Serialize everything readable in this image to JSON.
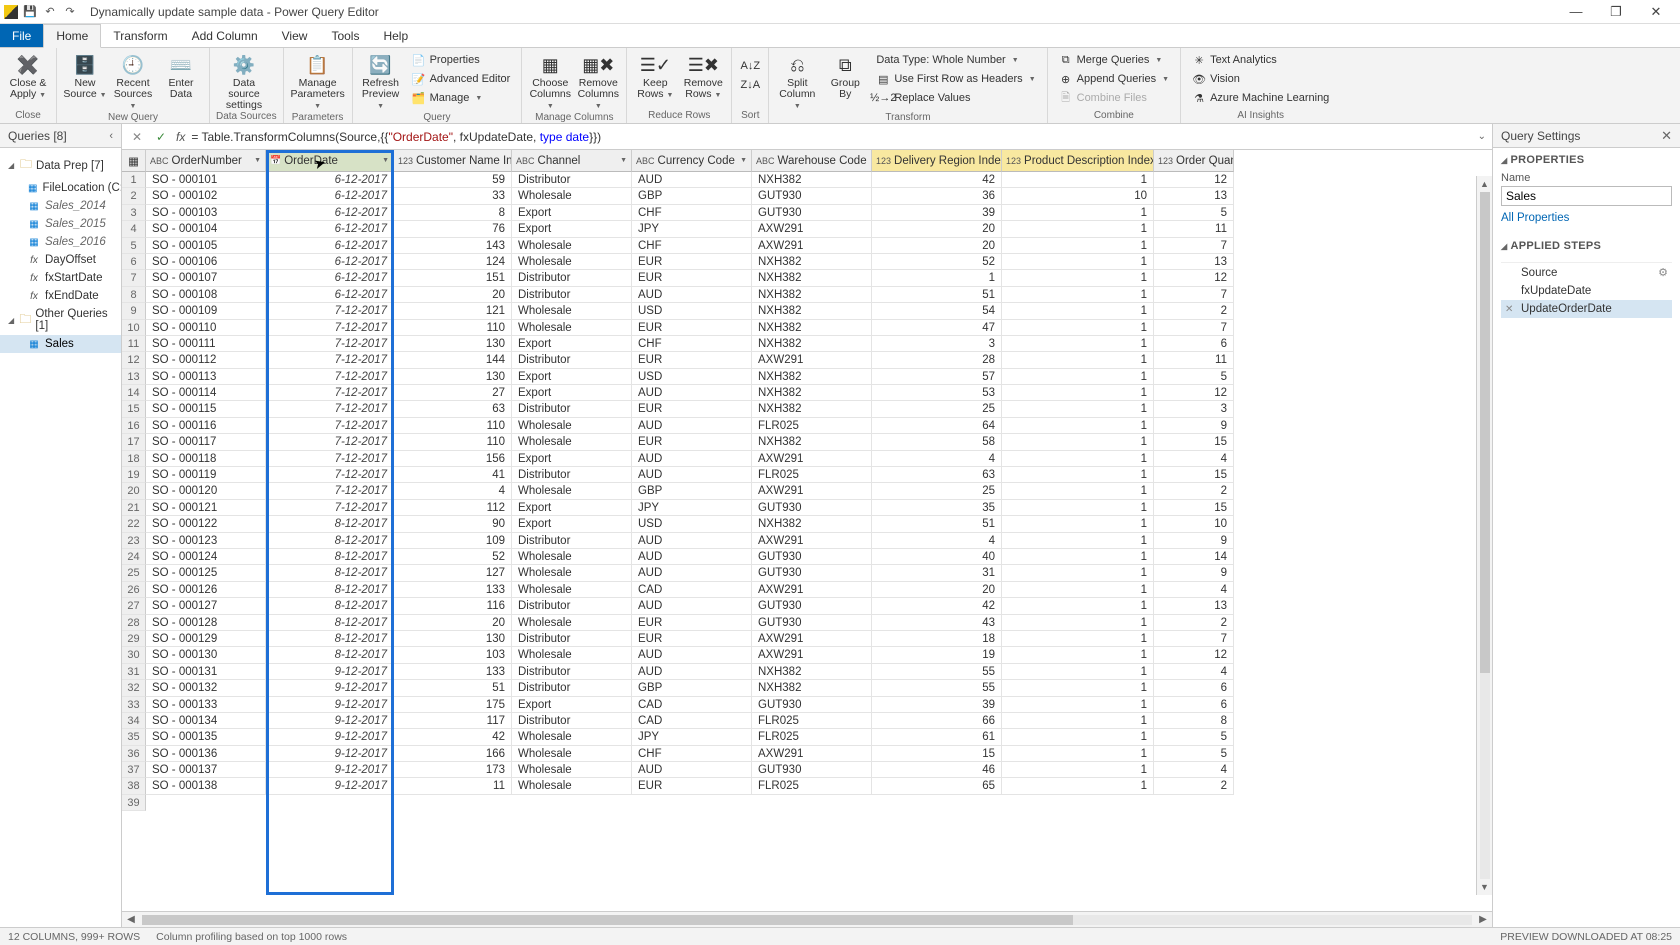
{
  "title": "Dynamically update sample data - Power Query Editor",
  "menuTabs": {
    "file": "File",
    "home": "Home",
    "transform": "Transform",
    "addColumn": "Add Column",
    "view": "View",
    "tools": "Tools",
    "help": "Help"
  },
  "ribbon": {
    "close": {
      "closeApply": "Close &\nApply",
      "group": "Close"
    },
    "newQuery": {
      "newSource": "New\nSource",
      "recentSources": "Recent\nSources",
      "enterData": "Enter\nData",
      "group": "New Query"
    },
    "dataSources": {
      "settings": "Data source\nsettings",
      "group": "Data Sources"
    },
    "parameters": {
      "manage": "Manage\nParameters",
      "group": "Parameters"
    },
    "query": {
      "refresh": "Refresh\nPreview",
      "properties": "Properties",
      "advEditor": "Advanced Editor",
      "manageQ": "Manage",
      "group": "Query"
    },
    "manageColumns": {
      "choose": "Choose\nColumns",
      "remove": "Remove\nColumns",
      "group": "Manage Columns"
    },
    "reduceRows": {
      "keep": "Keep\nRows",
      "removeR": "Remove\nRows",
      "group": "Reduce Rows"
    },
    "sort": {
      "group": "Sort"
    },
    "transform": {
      "split": "Split\nColumn",
      "groupBy": "Group\nBy",
      "dataType": "Data Type: Whole Number",
      "firstRow": "Use First Row as Headers",
      "replace": "Replace Values",
      "group": "Transform"
    },
    "combine": {
      "merge": "Merge Queries",
      "append": "Append Queries",
      "combineFiles": "Combine Files",
      "group": "Combine"
    },
    "ai": {
      "textAnalytics": "Text Analytics",
      "vision": "Vision",
      "azureML": "Azure Machine Learning",
      "group": "AI Insights"
    }
  },
  "queriesPanel": {
    "title": "Queries [8]",
    "groups": [
      {
        "name": "Data Prep [7]",
        "items": [
          {
            "label": "FileLocation (C:\\...",
            "type": "table"
          },
          {
            "label": "Sales_2014",
            "type": "table-italic"
          },
          {
            "label": "Sales_2015",
            "type": "table-italic"
          },
          {
            "label": "Sales_2016",
            "type": "table-italic"
          },
          {
            "label": "DayOffset",
            "type": "fx"
          },
          {
            "label": "fxStartDate",
            "type": "fx"
          },
          {
            "label": "fxEndDate",
            "type": "fx"
          }
        ]
      },
      {
        "name": "Other Queries [1]",
        "items": [
          {
            "label": "Sales",
            "type": "table",
            "selected": true
          }
        ]
      }
    ]
  },
  "formula": {
    "pre": "= Table.TransformColumns(Source,{{",
    "str": "\"OrderDate\"",
    "mid": ", fxUpdateDate, ",
    "kw": "type date",
    "post": "}})"
  },
  "columns": [
    {
      "name": "OrderNumber",
      "type": "ABC"
    },
    {
      "name": "OrderDate",
      "type": "📅",
      "selected": true
    },
    {
      "name": "Customer Name Index",
      "type": "123"
    },
    {
      "name": "Channel",
      "type": "ABC"
    },
    {
      "name": "Currency Code",
      "type": "ABC"
    },
    {
      "name": "Warehouse Code",
      "type": "ABC"
    },
    {
      "name": "Delivery Region Index",
      "type": "123",
      "highlight": 1
    },
    {
      "name": "Product Description Index",
      "type": "123",
      "highlight": 2
    },
    {
      "name": "Order Quantity",
      "type": "123"
    }
  ],
  "rows": [
    [
      "SO - 000101",
      "6-12-2017",
      59,
      "Distributor",
      "AUD",
      "NXH382",
      42,
      1,
      12
    ],
    [
      "SO - 000102",
      "6-12-2017",
      33,
      "Wholesale",
      "GBP",
      "GUT930",
      36,
      10,
      13
    ],
    [
      "SO - 000103",
      "6-12-2017",
      8,
      "Export",
      "CHF",
      "GUT930",
      39,
      1,
      5
    ],
    [
      "SO - 000104",
      "6-12-2017",
      76,
      "Export",
      "JPY",
      "AXW291",
      20,
      1,
      11
    ],
    [
      "SO - 000105",
      "6-12-2017",
      143,
      "Wholesale",
      "CHF",
      "AXW291",
      20,
      1,
      7
    ],
    [
      "SO - 000106",
      "6-12-2017",
      124,
      "Wholesale",
      "EUR",
      "NXH382",
      52,
      1,
      13
    ],
    [
      "SO - 000107",
      "6-12-2017",
      151,
      "Distributor",
      "EUR",
      "NXH382",
      1,
      1,
      12
    ],
    [
      "SO - 000108",
      "6-12-2017",
      20,
      "Distributor",
      "AUD",
      "NXH382",
      51,
      1,
      7
    ],
    [
      "SO - 000109",
      "7-12-2017",
      121,
      "Wholesale",
      "USD",
      "NXH382",
      54,
      1,
      2
    ],
    [
      "SO - 000110",
      "7-12-2017",
      110,
      "Wholesale",
      "EUR",
      "NXH382",
      47,
      1,
      7
    ],
    [
      "SO - 000111",
      "7-12-2017",
      130,
      "Export",
      "CHF",
      "NXH382",
      3,
      1,
      6
    ],
    [
      "SO - 000112",
      "7-12-2017",
      144,
      "Distributor",
      "EUR",
      "AXW291",
      28,
      1,
      11
    ],
    [
      "SO - 000113",
      "7-12-2017",
      130,
      "Export",
      "USD",
      "NXH382",
      57,
      1,
      5
    ],
    [
      "SO - 000114",
      "7-12-2017",
      27,
      "Export",
      "AUD",
      "NXH382",
      53,
      1,
      12
    ],
    [
      "SO - 000115",
      "7-12-2017",
      63,
      "Distributor",
      "EUR",
      "NXH382",
      25,
      1,
      3
    ],
    [
      "SO - 000116",
      "7-12-2017",
      110,
      "Wholesale",
      "AUD",
      "FLR025",
      64,
      1,
      9
    ],
    [
      "SO - 000117",
      "7-12-2017",
      110,
      "Wholesale",
      "EUR",
      "NXH382",
      58,
      1,
      15
    ],
    [
      "SO - 000118",
      "7-12-2017",
      156,
      "Export",
      "AUD",
      "AXW291",
      4,
      1,
      4
    ],
    [
      "SO - 000119",
      "7-12-2017",
      41,
      "Distributor",
      "AUD",
      "FLR025",
      63,
      1,
      15
    ],
    [
      "SO - 000120",
      "7-12-2017",
      4,
      "Wholesale",
      "GBP",
      "AXW291",
      25,
      1,
      2
    ],
    [
      "SO - 000121",
      "7-12-2017",
      112,
      "Export",
      "JPY",
      "GUT930",
      35,
      1,
      15
    ],
    [
      "SO - 000122",
      "8-12-2017",
      90,
      "Export",
      "USD",
      "NXH382",
      51,
      1,
      10
    ],
    [
      "SO - 000123",
      "8-12-2017",
      109,
      "Distributor",
      "AUD",
      "AXW291",
      4,
      1,
      9
    ],
    [
      "SO - 000124",
      "8-12-2017",
      52,
      "Wholesale",
      "AUD",
      "GUT930",
      40,
      1,
      14
    ],
    [
      "SO - 000125",
      "8-12-2017",
      127,
      "Wholesale",
      "AUD",
      "GUT930",
      31,
      1,
      9
    ],
    [
      "SO - 000126",
      "8-12-2017",
      133,
      "Wholesale",
      "CAD",
      "AXW291",
      20,
      1,
      4
    ],
    [
      "SO - 000127",
      "8-12-2017",
      116,
      "Distributor",
      "AUD",
      "GUT930",
      42,
      1,
      13
    ],
    [
      "SO - 000128",
      "8-12-2017",
      20,
      "Wholesale",
      "EUR",
      "GUT930",
      43,
      1,
      2
    ],
    [
      "SO - 000129",
      "8-12-2017",
      130,
      "Distributor",
      "EUR",
      "AXW291",
      18,
      1,
      7
    ],
    [
      "SO - 000130",
      "8-12-2017",
      103,
      "Wholesale",
      "AUD",
      "AXW291",
      19,
      1,
      12
    ],
    [
      "SO - 000131",
      "9-12-2017",
      133,
      "Distributor",
      "AUD",
      "NXH382",
      55,
      1,
      4
    ],
    [
      "SO - 000132",
      "9-12-2017",
      51,
      "Distributor",
      "GBP",
      "NXH382",
      55,
      1,
      6
    ],
    [
      "SO - 000133",
      "9-12-2017",
      175,
      "Export",
      "CAD",
      "GUT930",
      39,
      1,
      6
    ],
    [
      "SO - 000134",
      "9-12-2017",
      117,
      "Distributor",
      "CAD",
      "FLR025",
      66,
      1,
      8
    ],
    [
      "SO - 000135",
      "9-12-2017",
      42,
      "Wholesale",
      "JPY",
      "FLR025",
      61,
      1,
      5
    ],
    [
      "SO - 000136",
      "9-12-2017",
      166,
      "Wholesale",
      "CHF",
      "AXW291",
      15,
      1,
      5
    ],
    [
      "SO - 000137",
      "9-12-2017",
      173,
      "Wholesale",
      "AUD",
      "GUT930",
      46,
      1,
      4
    ],
    [
      "SO - 000138",
      "9-12-2017",
      11,
      "Wholesale",
      "EUR",
      "FLR025",
      65,
      1,
      2
    ]
  ],
  "extraRow": "39",
  "settings": {
    "title": "Query Settings",
    "propsTitle": "PROPERTIES",
    "nameLabel": "Name",
    "nameValue": "Sales",
    "allProps": "All Properties",
    "stepsTitle": "APPLIED STEPS",
    "steps": [
      {
        "label": "Source"
      },
      {
        "label": "fxUpdateDate"
      },
      {
        "label": "UpdateOrderDate",
        "selected": true
      }
    ]
  },
  "status": {
    "left1": "12 COLUMNS, 999+ ROWS",
    "left2": "Column profiling based on top 1000 rows",
    "right": "PREVIEW DOWNLOADED AT 08:25"
  }
}
